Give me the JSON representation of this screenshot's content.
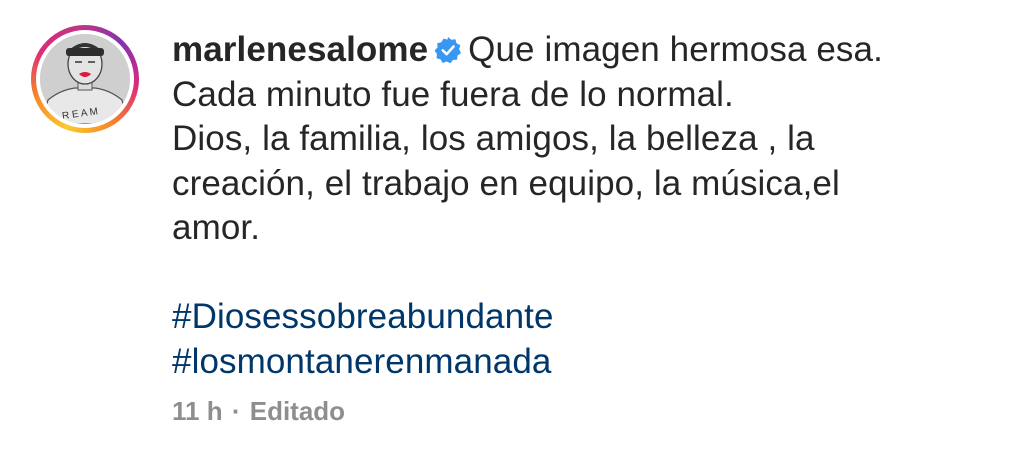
{
  "post": {
    "avatar_icon": "profile-avatar",
    "username": "marlenesalome",
    "verified_icon": "verified-badge-icon",
    "verified_color": "#3897f0",
    "caption_lines": [
      "Que imagen hermosa esa.",
      "Cada minuto fue fuera de lo normal.",
      "Dios, la familia, los amigos, la belleza , la",
      "creación, el trabajo en equipo, la música,el",
      "amor."
    ],
    "hashtags": [
      "#Diosessobreabundante",
      "#losmontanerenmanada"
    ],
    "hashtag_color": "#00376b",
    "timestamp": "11 h",
    "separator": "·",
    "edited_label": "Editado"
  }
}
